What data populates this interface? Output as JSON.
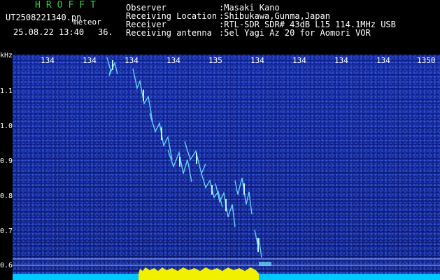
{
  "header": {
    "app_title": "HROFFT",
    "filename": "UT2508221340.pn",
    "meteor_type": "meteor",
    "datetime": "25.08.22 13:40",
    "count": "36.",
    "fields": [
      {
        "label": "Observer",
        "value": ":Masaki Kano"
      },
      {
        "label": "Receiving Location",
        "value": ":Shibukawa,Gunma,Japan"
      },
      {
        "label": "Receiver",
        "value": ":RTL-SDR SDR# 43dB L15 114.1MHz USB"
      },
      {
        "label": "Receiving antenna",
        "value": ":5el Yagi Az 20 for Aomori VOR"
      }
    ]
  },
  "spectrogram": {
    "unit": "kHz",
    "y_ticks": [
      "1.1",
      "1.0",
      "0.9",
      "0.8",
      "0.7",
      "0.6"
    ],
    "x_ticks": [
      "134",
      "134",
      "134",
      "134",
      "135",
      "134",
      "134",
      "134",
      "134",
      "1350"
    ],
    "colors": {
      "background": "#0e1e8c",
      "signal": "#6fe0ff",
      "baseline": "#00c8ff",
      "burst": "#f0f000"
    }
  }
}
